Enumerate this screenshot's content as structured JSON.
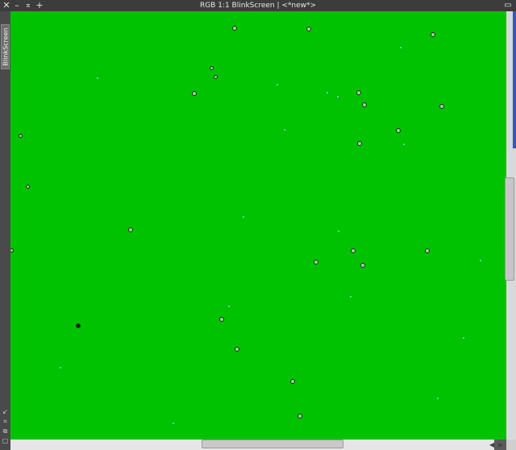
{
  "window": {
    "title": "RGB 1:1 BlinkScreen | <*new*>",
    "buttons": {
      "close": "✕",
      "minimize": "–",
      "shade": "⌅",
      "maximize": "+",
      "restore": "▭"
    }
  },
  "sidebar": {
    "tab_label": "BlinkScreen",
    "icons": [
      "↙",
      "⌗",
      "⧉",
      "▢"
    ]
  },
  "image": {
    "background_color": "#00c200",
    "stars_marked": 28
  },
  "scrollbars": {
    "left_arrow": "◀",
    "right_arrow": "▶"
  }
}
